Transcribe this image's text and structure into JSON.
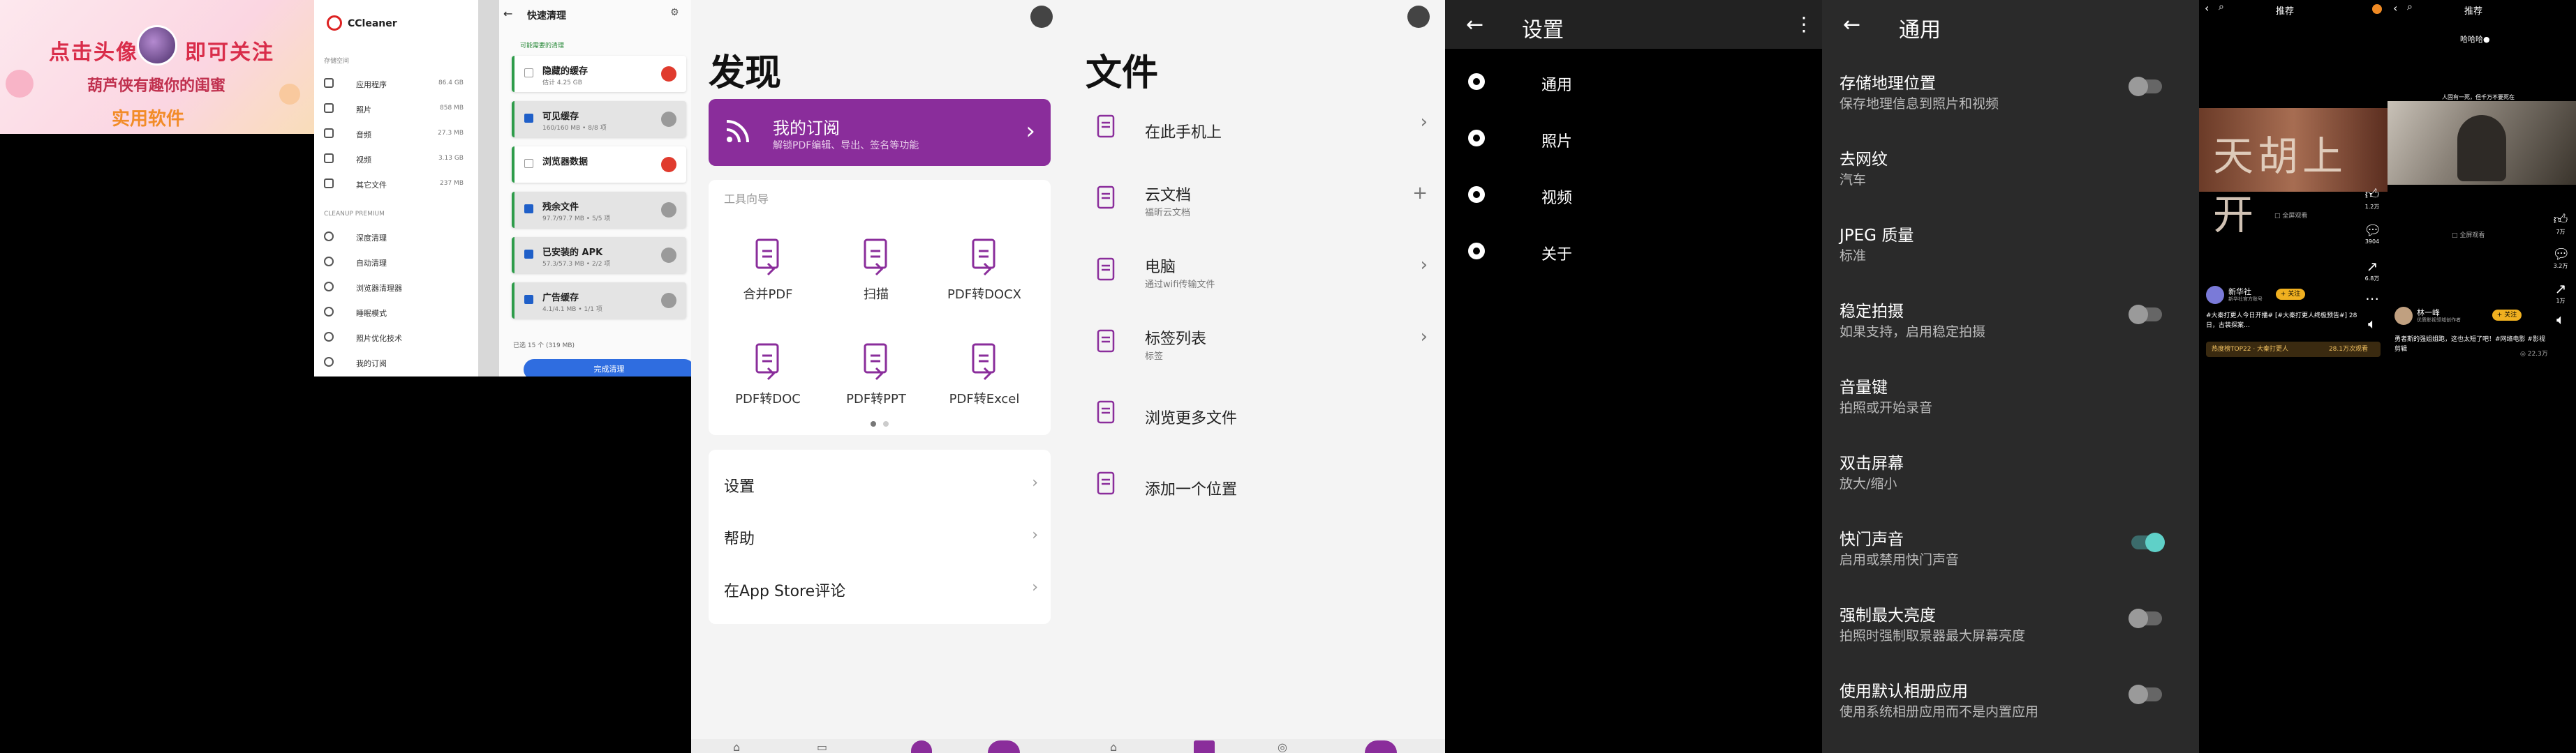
{
  "banner": {
    "text_left": "点击头像",
    "text_right": "即可关注",
    "line2": "葫芦侠有趣你的闺蜜",
    "line3": "实用软件"
  },
  "ccleaner": {
    "brand": "CCleaner",
    "section_storage": "存储空间",
    "menu": [
      {
        "label": "应用程序",
        "size": "86.4 GB",
        "icon": "apps-icon"
      },
      {
        "label": "照片",
        "size": "858 MB",
        "icon": "photo-icon"
      },
      {
        "label": "音频",
        "size": "27.3 MB",
        "icon": "music-icon"
      },
      {
        "label": "视频",
        "size": "3.13 GB",
        "icon": "video-icon"
      },
      {
        "label": "其它文件",
        "size": "237 MB",
        "icon": "file-icon"
      }
    ],
    "section_premium": "CLEANUP PREMIUM",
    "premium": [
      "深度清理",
      "自动清理",
      "浏览器清理器",
      "睡眠模式",
      "照片优化技术",
      "我的订阅"
    ],
    "quick_title": "快速清理",
    "quick_sub": "可能需要的清理",
    "cards": [
      {
        "name": "隐藏的缓存",
        "desc": "估计 4.25 GB",
        "checked": false,
        "status": "red",
        "gray": false
      },
      {
        "name": "可见缓存",
        "desc": "160/160 MB • 8/8 项",
        "checked": true,
        "status": "grey",
        "gray": true
      },
      {
        "name": "浏览器数据",
        "desc": "",
        "checked": false,
        "status": "red",
        "gray": false
      },
      {
        "name": "残余文件",
        "desc": "97.7/97.7 MB • 5/5 项",
        "checked": true,
        "status": "grey",
        "gray": true
      },
      {
        "name": "已安装的 APK",
        "desc": "57.3/57.3 MB • 2/2 项",
        "checked": true,
        "status": "grey",
        "gray": true
      },
      {
        "name": "广告缓存",
        "desc": "4.1/4.1 MB • 1/1 项",
        "checked": true,
        "status": "grey",
        "gray": true
      }
    ],
    "foot": "已选 15 个 (319 MB)",
    "done_label": "完成清理"
  },
  "discover": {
    "title": "发现",
    "subscription": {
      "title": "我的订阅",
      "desc": "解锁PDF编辑、导出、签名等功能"
    },
    "tools_header": "工具向导",
    "tools": [
      {
        "label": "合并PDF",
        "icon": "merge-pdf-icon"
      },
      {
        "label": "扫描",
        "icon": "scan-icon"
      },
      {
        "label": "PDF转DOCX",
        "icon": "pdf-to-docx-icon"
      },
      {
        "label": "PDF转DOC",
        "icon": "pdf-to-doc-icon"
      },
      {
        "label": "PDF转PPT",
        "icon": "pdf-to-ppt-icon"
      },
      {
        "label": "PDF转Excel",
        "icon": "pdf-to-excel-icon"
      }
    ],
    "menu": [
      "设置",
      "帮助",
      "在App Store评论"
    ],
    "accent": "#8a2d9b"
  },
  "files": {
    "title": "文件",
    "rows": [
      {
        "label": "在此手机上",
        "desc": "",
        "icon": "phone-icon",
        "action": "›"
      },
      {
        "label": "云文档",
        "desc": "福昕云文档",
        "icon": "cloud-doc-icon",
        "action": "+"
      },
      {
        "label": "电脑",
        "desc": "通过wifi传输文件",
        "icon": "computer-icon",
        "action": "›"
      },
      {
        "label": "标签列表",
        "desc": "标签",
        "icon": "tag-icon",
        "action": "›"
      },
      {
        "label": "浏览更多文件",
        "desc": "",
        "icon": "folder-icon",
        "action": ""
      },
      {
        "label": "添加一个位置",
        "desc": "",
        "icon": "plus-icon",
        "action": ""
      }
    ]
  },
  "settings": {
    "title": "设置",
    "items": [
      {
        "label": "通用",
        "icon": "aperture-icon"
      },
      {
        "label": "照片",
        "icon": "camera-icon"
      },
      {
        "label": "视频",
        "icon": "video-camera-icon"
      },
      {
        "label": "关于",
        "icon": "info-icon"
      }
    ]
  },
  "general": {
    "title": "通用",
    "options": [
      {
        "title": "存储地理位置",
        "desc": "保存地理信息到照片和视频",
        "toggle": "off"
      },
      {
        "title": "去网纹",
        "desc": "汽车",
        "toggle": "none"
      },
      {
        "title": "JPEG 质量",
        "desc": "标准",
        "toggle": "none"
      },
      {
        "title": "稳定拍摄",
        "desc": "如果支持，启用稳定拍摄",
        "toggle": "off"
      },
      {
        "title": "音量键",
        "desc": "拍照或开始录音",
        "toggle": "none"
      },
      {
        "title": "双击屏幕",
        "desc": "放大/缩小",
        "toggle": "none"
      },
      {
        "title": "快门声音",
        "desc": "启用或禁用快门声音",
        "toggle": "on"
      },
      {
        "title": "强制最大亮度",
        "desc": "拍照时强制取景器最大屏幕亮度",
        "toggle": "off"
      },
      {
        "title": "使用默认相册应用",
        "desc": "使用系统相册应用而不是内置应用",
        "toggle": "off"
      }
    ]
  },
  "video1": {
    "top_center": "推荐",
    "overlay": "天胡上开",
    "hint": "□ 全屏观看",
    "likes": "1.2万",
    "comments": "3904",
    "shares": "6.8万",
    "author": "新华社",
    "follow": "+ 关注",
    "verified": "新华社官方账号",
    "caption": "#大秦打更人今日开播# [#大秦打更人终极预告#] 28日，古装探案…",
    "chip": "热度榜TOP22 · 大秦打更人",
    "chip_right": "28.1万次观看"
  },
  "video2": {
    "top_center": "推荐",
    "tag": "哈哈哈●",
    "overlay": "人固有一死，但千万不要死在",
    "hint": "□ 全屏观看",
    "likes": "7万",
    "comments": "3.2万",
    "shares": "1万",
    "author": "林一峰",
    "follow": "+ 关注",
    "verified": "优质影视领域创作者",
    "caption": "勇者斯的强姐姐跑，这也太短了吧！#网络电影 #影视剪辑",
    "muted_right": "◎ 22.3万"
  }
}
